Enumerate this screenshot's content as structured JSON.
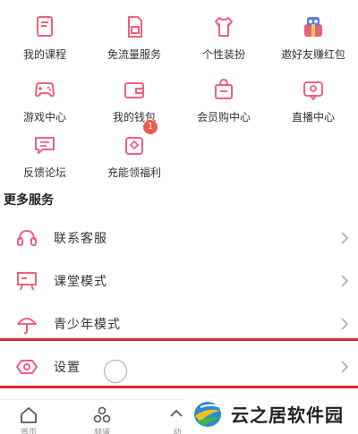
{
  "grid": [
    {
      "label": "我的课程",
      "icon": "book-icon"
    },
    {
      "label": "免流量服务",
      "icon": "sim-card-icon"
    },
    {
      "label": "个性装扮",
      "icon": "tshirt-icon"
    },
    {
      "label": "邀好友赚红包",
      "icon": "gift-robot-icon"
    },
    {
      "label": "游戏中心",
      "icon": "gamepad-icon"
    },
    {
      "label": "我的钱包",
      "icon": "wallet-icon"
    },
    {
      "label": "会员购中心",
      "icon": "shopping-bag-icon"
    },
    {
      "label": "直播中心",
      "icon": "live-tv-icon"
    },
    {
      "label": "反馈论坛",
      "icon": "chat-bubble-icon"
    },
    {
      "label": "充能领福利",
      "icon": "welfare-icon",
      "badge": "1"
    }
  ],
  "more_services": {
    "title": "更多服务",
    "items": [
      {
        "label": "联系客服",
        "icon": "headset-icon"
      },
      {
        "label": "课堂模式",
        "icon": "classroom-icon"
      },
      {
        "label": "青少年模式",
        "icon": "umbrella-icon"
      },
      {
        "label": "设置",
        "icon": "settings-icon"
      }
    ]
  },
  "tabbar": [
    {
      "label": "首页",
      "icon": "home-icon"
    },
    {
      "label": "频道",
      "icon": "channels-icon"
    },
    {
      "label": "动",
      "icon": "dynamic-icon"
    }
  ],
  "watermark": {
    "text": "云之居软件园"
  },
  "colors": {
    "accent": "#f0607e",
    "highlight": "#e0283a",
    "badge": "#f05a4a"
  }
}
